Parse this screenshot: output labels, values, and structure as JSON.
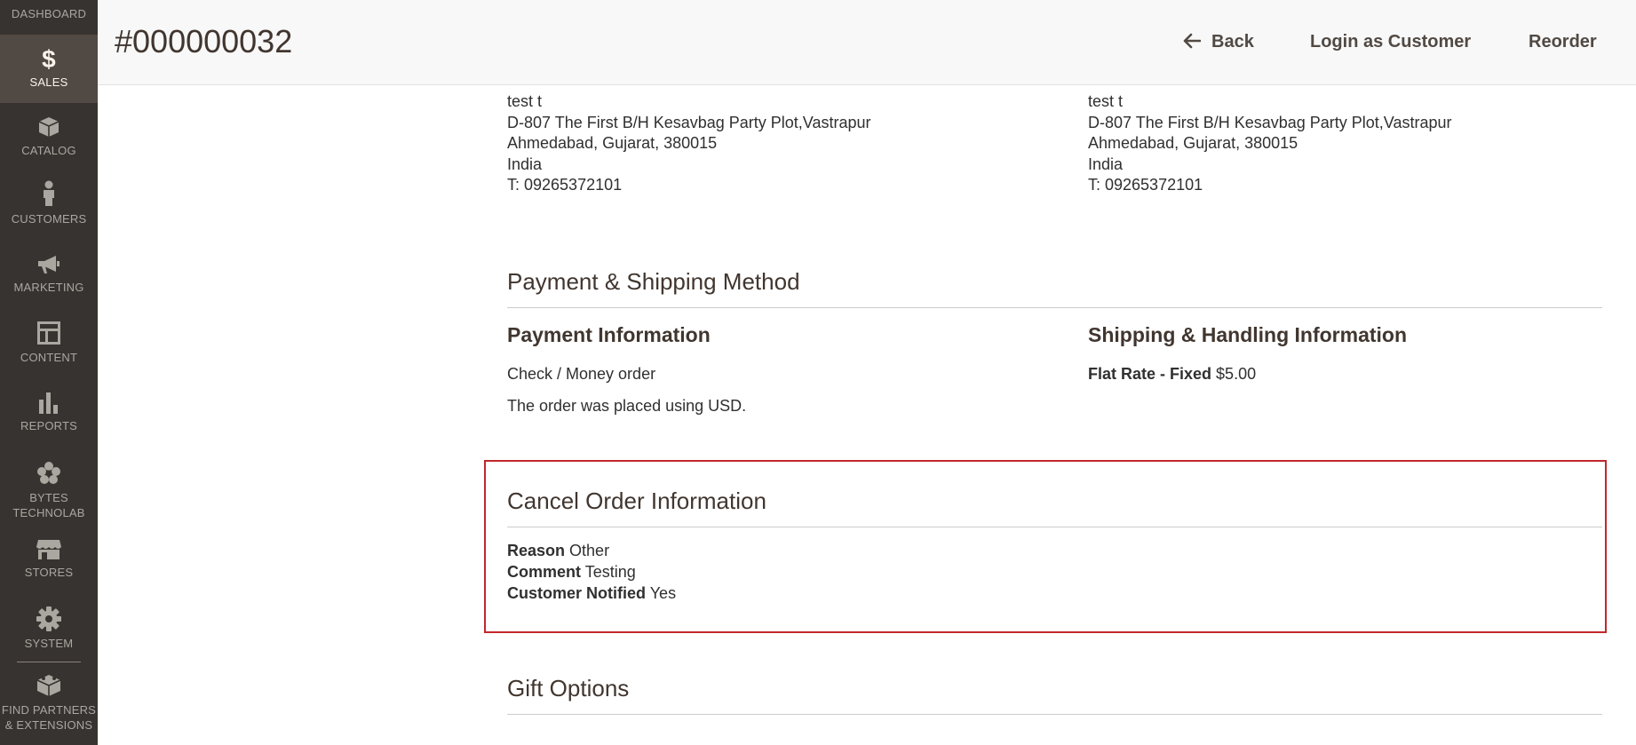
{
  "sidebar": {
    "items": [
      {
        "label": "DASHBOARD",
        "icon": "dashboard-icon"
      },
      {
        "label": "SALES",
        "icon": "dollar-icon",
        "active": true
      },
      {
        "label": "CATALOG",
        "icon": "box-icon"
      },
      {
        "label": "CUSTOMERS",
        "icon": "person-icon"
      },
      {
        "label": "MARKETING",
        "icon": "megaphone-icon"
      },
      {
        "label": "CONTENT",
        "icon": "layout-icon"
      },
      {
        "label": "REPORTS",
        "icon": "bar-chart-icon"
      },
      {
        "label_line1": "BYTES",
        "label_line2": "TECHNOLAB",
        "icon": "flower-icon"
      },
      {
        "label": "STORES",
        "icon": "storefront-icon"
      },
      {
        "label": "SYSTEM",
        "icon": "gear-icon"
      },
      {
        "label_line1": "FIND PARTNERS",
        "label_line2": "& EXTENSIONS",
        "icon": "blocks-icon"
      }
    ]
  },
  "header": {
    "title": "#000000032",
    "back_label": "Back",
    "login_label": "Login as Customer",
    "reorder_label": "Reorder"
  },
  "billing_address": {
    "name": "test t",
    "street": "D-807 The First B/H Kesavbag Party Plot,Vastrapur",
    "city_line": "Ahmedabad, Gujarat, 380015",
    "country": "India",
    "phone": "T: 09265372101"
  },
  "shipping_address": {
    "name": "test t",
    "street": "D-807 The First B/H Kesavbag Party Plot,Vastrapur",
    "city_line": "Ahmedabad, Gujarat, 380015",
    "country": "India",
    "phone": "T: 09265372101"
  },
  "payment_shipping": {
    "title": "Payment & Shipping Method",
    "payment_title": "Payment Information",
    "payment_method": "Check / Money order",
    "currency_note": "The order was placed using USD.",
    "shipping_title": "Shipping & Handling Information",
    "shipping_method": "Flat Rate - Fixed",
    "shipping_price": "$5.00"
  },
  "cancel_info": {
    "title": "Cancel Order Information",
    "reason_label": "Reason",
    "reason_value": "Other",
    "comment_label": "Comment",
    "comment_value": "Testing",
    "notified_label": "Customer Notified",
    "notified_value": "Yes",
    "highlight_color": "#c1272d"
  },
  "gift_options": {
    "title": "Gift Options"
  }
}
